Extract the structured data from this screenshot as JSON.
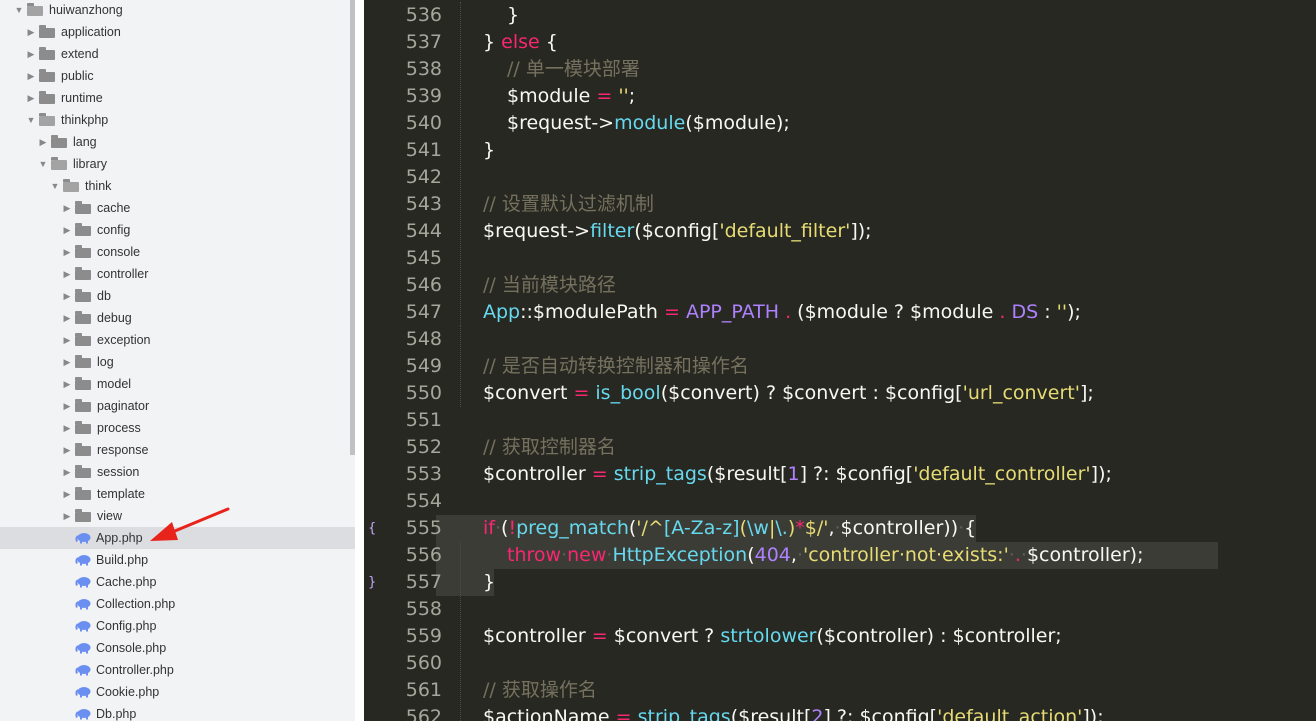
{
  "sidebar": {
    "tree": [
      {
        "label": "huiwanzhong",
        "depth": 0,
        "type": "folder",
        "expanded": true
      },
      {
        "label": "application",
        "depth": 1,
        "type": "folder",
        "expanded": false
      },
      {
        "label": "extend",
        "depth": 1,
        "type": "folder",
        "expanded": false
      },
      {
        "label": "public",
        "depth": 1,
        "type": "folder",
        "expanded": false
      },
      {
        "label": "runtime",
        "depth": 1,
        "type": "folder",
        "expanded": false
      },
      {
        "label": "thinkphp",
        "depth": 1,
        "type": "folder",
        "expanded": true
      },
      {
        "label": "lang",
        "depth": 2,
        "type": "folder",
        "expanded": false
      },
      {
        "label": "library",
        "depth": 2,
        "type": "folder",
        "expanded": true
      },
      {
        "label": "think",
        "depth": 3,
        "type": "folder",
        "expanded": true
      },
      {
        "label": "cache",
        "depth": 4,
        "type": "folder",
        "expanded": false
      },
      {
        "label": "config",
        "depth": 4,
        "type": "folder",
        "expanded": false
      },
      {
        "label": "console",
        "depth": 4,
        "type": "folder",
        "expanded": false
      },
      {
        "label": "controller",
        "depth": 4,
        "type": "folder",
        "expanded": false
      },
      {
        "label": "db",
        "depth": 4,
        "type": "folder",
        "expanded": false
      },
      {
        "label": "debug",
        "depth": 4,
        "type": "folder",
        "expanded": false
      },
      {
        "label": "exception",
        "depth": 4,
        "type": "folder",
        "expanded": false
      },
      {
        "label": "log",
        "depth": 4,
        "type": "folder",
        "expanded": false
      },
      {
        "label": "model",
        "depth": 4,
        "type": "folder",
        "expanded": false
      },
      {
        "label": "paginator",
        "depth": 4,
        "type": "folder",
        "expanded": false
      },
      {
        "label": "process",
        "depth": 4,
        "type": "folder",
        "expanded": false
      },
      {
        "label": "response",
        "depth": 4,
        "type": "folder",
        "expanded": false
      },
      {
        "label": "session",
        "depth": 4,
        "type": "folder",
        "expanded": false
      },
      {
        "label": "template",
        "depth": 4,
        "type": "folder",
        "expanded": false
      },
      {
        "label": "view",
        "depth": 4,
        "type": "folder",
        "expanded": false
      },
      {
        "label": "App.php",
        "depth": 4,
        "type": "php",
        "selected": true
      },
      {
        "label": "Build.php",
        "depth": 4,
        "type": "php"
      },
      {
        "label": "Cache.php",
        "depth": 4,
        "type": "php"
      },
      {
        "label": "Collection.php",
        "depth": 4,
        "type": "php"
      },
      {
        "label": "Config.php",
        "depth": 4,
        "type": "php"
      },
      {
        "label": "Console.php",
        "depth": 4,
        "type": "php"
      },
      {
        "label": "Controller.php",
        "depth": 4,
        "type": "php"
      },
      {
        "label": "Cookie.php",
        "depth": 4,
        "type": "php"
      },
      {
        "label": "Db.php",
        "depth": 4,
        "type": "php"
      }
    ]
  },
  "annotation": {
    "arrow_icon": "red-arrow-icon",
    "color": "#e8231c"
  },
  "editor": {
    "theme": {
      "background": "#272822",
      "comment": "#75715e",
      "keyword": "#f92672",
      "function": "#66d9ef",
      "string": "#e6db74",
      "number": "#ae81ff"
    },
    "lines": [
      {
        "num": "536",
        "indent": 2,
        "tokens": [
          [
            "p",
            "}"
          ]
        ]
      },
      {
        "num": "537",
        "indent": 1,
        "tokens": [
          [
            "p",
            "} "
          ],
          [
            "kw",
            "else"
          ],
          [
            "p",
            " {"
          ]
        ]
      },
      {
        "num": "538",
        "indent": 2,
        "tokens": [
          [
            "cm",
            "// 单一模块部署"
          ]
        ]
      },
      {
        "num": "539",
        "indent": 2,
        "tokens": [
          [
            "p",
            "$module "
          ],
          [
            "op",
            "="
          ],
          [
            "p",
            " "
          ],
          [
            "str",
            "''"
          ],
          [
            "p",
            ";"
          ]
        ]
      },
      {
        "num": "540",
        "indent": 2,
        "tokens": [
          [
            "p",
            "$request->"
          ],
          [
            "fn",
            "module"
          ],
          [
            "p",
            "($module);"
          ]
        ]
      },
      {
        "num": "541",
        "indent": 1,
        "tokens": [
          [
            "p",
            "}"
          ]
        ]
      },
      {
        "num": "542",
        "indent": 0,
        "tokens": []
      },
      {
        "num": "543",
        "indent": 1,
        "tokens": [
          [
            "cm",
            "// 设置默认过滤机制"
          ]
        ]
      },
      {
        "num": "544",
        "indent": 1,
        "tokens": [
          [
            "p",
            "$request->"
          ],
          [
            "fn",
            "filter"
          ],
          [
            "p",
            "($config["
          ],
          [
            "str",
            "'default_filter'"
          ],
          [
            "p",
            "]);"
          ]
        ]
      },
      {
        "num": "545",
        "indent": 0,
        "tokens": []
      },
      {
        "num": "546",
        "indent": 1,
        "tokens": [
          [
            "cm",
            "// 当前模块路径"
          ]
        ]
      },
      {
        "num": "547",
        "indent": 1,
        "tokens": [
          [
            "cls",
            "App"
          ],
          [
            "p",
            "::$modulePath "
          ],
          [
            "op",
            "="
          ],
          [
            "p",
            " "
          ],
          [
            "const",
            "APP_PATH"
          ],
          [
            "p",
            " "
          ],
          [
            "op",
            "."
          ],
          [
            "p",
            " ($module ? $module "
          ],
          [
            "op",
            "."
          ],
          [
            "p",
            " "
          ],
          [
            "const",
            "DS"
          ],
          [
            "p",
            " : "
          ],
          [
            "str",
            "''"
          ],
          [
            "p",
            ");"
          ]
        ]
      },
      {
        "num": "548",
        "indent": 0,
        "tokens": []
      },
      {
        "num": "549",
        "indent": 1,
        "tokens": [
          [
            "cm",
            "// 是否自动转换控制器和操作名"
          ]
        ]
      },
      {
        "num": "550",
        "indent": 1,
        "tokens": [
          [
            "p",
            "$convert "
          ],
          [
            "op",
            "="
          ],
          [
            "p",
            " "
          ],
          [
            "fn",
            "is_bool"
          ],
          [
            "p",
            "($convert) ? $convert : $config["
          ],
          [
            "str",
            "'url_convert'"
          ],
          [
            "p",
            "];"
          ]
        ]
      },
      {
        "num": "551",
        "indent": 0,
        "tokens": []
      },
      {
        "num": "552",
        "indent": 1,
        "tokens": [
          [
            "cm",
            "// 获取控制器名"
          ]
        ]
      },
      {
        "num": "553",
        "indent": 1,
        "tokens": [
          [
            "p",
            "$controller "
          ],
          [
            "op",
            "="
          ],
          [
            "p",
            " "
          ],
          [
            "fn",
            "strip_tags"
          ],
          [
            "p",
            "($result["
          ],
          [
            "num",
            "1"
          ],
          [
            "p",
            "] ?: $config["
          ],
          [
            "str",
            "'default_controller'"
          ],
          [
            "p",
            "]);"
          ]
        ]
      },
      {
        "num": "554",
        "indent": 0,
        "tokens": []
      },
      {
        "num": "555",
        "indent": 1,
        "fold": "{",
        "hl": true,
        "tokens": [
          [
            "kw",
            "if"
          ],
          [
            "ws",
            "·"
          ],
          [
            "p",
            "("
          ],
          [
            "op",
            "!"
          ],
          [
            "fn",
            "preg_match"
          ],
          [
            "p",
            "("
          ],
          [
            "str",
            "'/^"
          ],
          [
            "fn",
            "[A-Za-z]"
          ],
          [
            "str",
            "("
          ],
          [
            "fn",
            "\\w"
          ],
          [
            "str",
            "|"
          ],
          [
            "fn",
            "\\."
          ],
          [
            "str",
            ")"
          ],
          [
            "op",
            "*"
          ],
          [
            "str",
            "$/'"
          ],
          [
            "p",
            ","
          ],
          [
            "ws",
            "·"
          ],
          [
            "p",
            "$controller))"
          ],
          [
            "ws",
            "·"
          ],
          [
            "p",
            "{"
          ]
        ]
      },
      {
        "num": "556",
        "indent": 2,
        "hl": true,
        "tokens": [
          [
            "kw",
            "throw"
          ],
          [
            "ws",
            "·"
          ],
          [
            "kw",
            "new"
          ],
          [
            "ws",
            "·"
          ],
          [
            "fn",
            "HttpException"
          ],
          [
            "p",
            "("
          ],
          [
            "num",
            "404"
          ],
          [
            "p",
            ","
          ],
          [
            "ws",
            "·"
          ],
          [
            "str",
            "'controller·not·exists:'"
          ],
          [
            "ws",
            "·"
          ],
          [
            "op",
            "."
          ],
          [
            "ws",
            "·"
          ],
          [
            "p",
            "$controller);"
          ]
        ]
      },
      {
        "num": "557",
        "indent": 1,
        "fold": "}",
        "hl": true,
        "tokens": [
          [
            "p",
            "}"
          ]
        ]
      },
      {
        "num": "558",
        "indent": 0,
        "tokens": []
      },
      {
        "num": "559",
        "indent": 1,
        "tokens": [
          [
            "p",
            "$controller "
          ],
          [
            "op",
            "="
          ],
          [
            "p",
            " $convert ? "
          ],
          [
            "fn",
            "strtolower"
          ],
          [
            "p",
            "($controller) : $controller;"
          ]
        ]
      },
      {
        "num": "560",
        "indent": 0,
        "tokens": []
      },
      {
        "num": "561",
        "indent": 1,
        "tokens": [
          [
            "cm",
            "// 获取操作名"
          ]
        ]
      },
      {
        "num": "562",
        "indent": 1,
        "tokens": [
          [
            "p",
            "$actionName "
          ],
          [
            "op",
            "="
          ],
          [
            "p",
            " "
          ],
          [
            "fn",
            "strip_tags"
          ],
          [
            "p",
            "($result["
          ],
          [
            "num",
            "2"
          ],
          [
            "p",
            "] ?: $config["
          ],
          [
            "str",
            "'default_action'"
          ],
          [
            "p",
            "]);"
          ]
        ]
      }
    ]
  }
}
